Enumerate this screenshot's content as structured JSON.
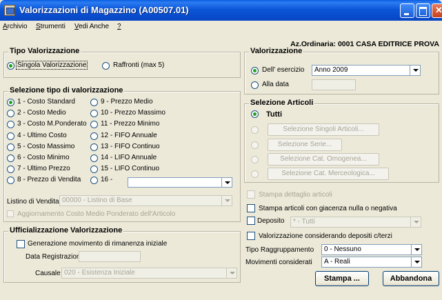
{
  "window": {
    "title": "Valorizzazioni di Magazzino (A00507.01)",
    "icon": "app-window-icon"
  },
  "menu": [
    {
      "label": "Archivio",
      "u": "A",
      "rest": "rchivio"
    },
    {
      "label": "Strumenti",
      "u": "S",
      "rest": "trumenti"
    },
    {
      "label": "Vedi Anche",
      "u": "V",
      "rest": "edi Anche"
    },
    {
      "label": "?",
      "u": "?",
      "rest": ""
    }
  ],
  "company": "Az.Ordinaria: 0001 CASA EDITRICE PROVA",
  "tipo_valorizzazione": {
    "title": "Tipo Valorizzazione",
    "option1": "Singola Valorizzazione",
    "option2": "Raffronti (max 5)",
    "selected": "Singola Valorizzazione"
  },
  "selezione_tipo": {
    "title": "Selezione tipo di valorizzazione",
    "left": [
      "1 - Costo Standard",
      "2 - Costo Medio",
      "3 - Costo M.Ponderato",
      "4 - Ultimo Costo",
      "5 - Costo Massimo",
      "6 - Costo Minimo",
      "7 - Ultimo Prezzo",
      "8 - Prezzo di Vendita"
    ],
    "right": [
      "9 - Prezzo Medio",
      "10 - Prezzo Massimo",
      "11 - Prezzo Minimo",
      "12 - FIFO Annuale",
      "13 - FIFO Continuo",
      "14 - LIFO Annuale",
      "15 - LIFO Continuo",
      "16 -"
    ],
    "selected": "1 - Costo Standard",
    "option16_value": "",
    "listino_label": "Listino di Vendita",
    "listino_value": "00000 - Listino di Base",
    "aggiornamento_label": "Aggiornamento Costo Medio Ponderato dell'Articolo"
  },
  "ufficializzazione": {
    "title": "Ufficializzazione Valorizzazione",
    "generazione_label": "Generazione movimento di rimanenza iniziale",
    "data_label": "Data Registrazione",
    "data_value": "",
    "causale_label": "Causale",
    "causale_value": "020 - Esistenza Iniziale"
  },
  "valorizzazione": {
    "title": "Valorizzazione",
    "esercizio_label": "Dell' esercizio",
    "esercizio_value": "Anno 2009",
    "data_label": "Alla data",
    "data_value": ""
  },
  "selezione_articoli": {
    "title": "Selezione Articoli",
    "tutti_label": "Tutti",
    "buttons": [
      "Selezione Singoli Articoli...",
      "Selezione Serie...",
      "Selezione Cat. Omogenea...",
      "Selezione Cat. Merceologica..."
    ]
  },
  "options": {
    "stampa_dettaglio": "Stampa dettaglio articoli",
    "stampa_giacenza": "Stampa articoli con giacenza nulla o negativa",
    "deposito_label": "Deposito",
    "deposito_value": "* - Tutti",
    "valorizzazione_depositi": "Valorizzazione considerando depositi c/terzi",
    "raggruppamento_label": "Tipo Raggruppamento",
    "raggruppamento_value": "0 - Nessuno",
    "movimenti_label": "Movimenti considerati",
    "movimenti_value": "A - Reali"
  },
  "actions": {
    "stampa": "Stampa ...",
    "abbandona": "Abbandona"
  },
  "colors": {
    "titlebar": "#0b56d8",
    "dialog_bg": "#ece9d8",
    "radio_dot": "#21a121",
    "disabled_text": "#a8a597"
  }
}
